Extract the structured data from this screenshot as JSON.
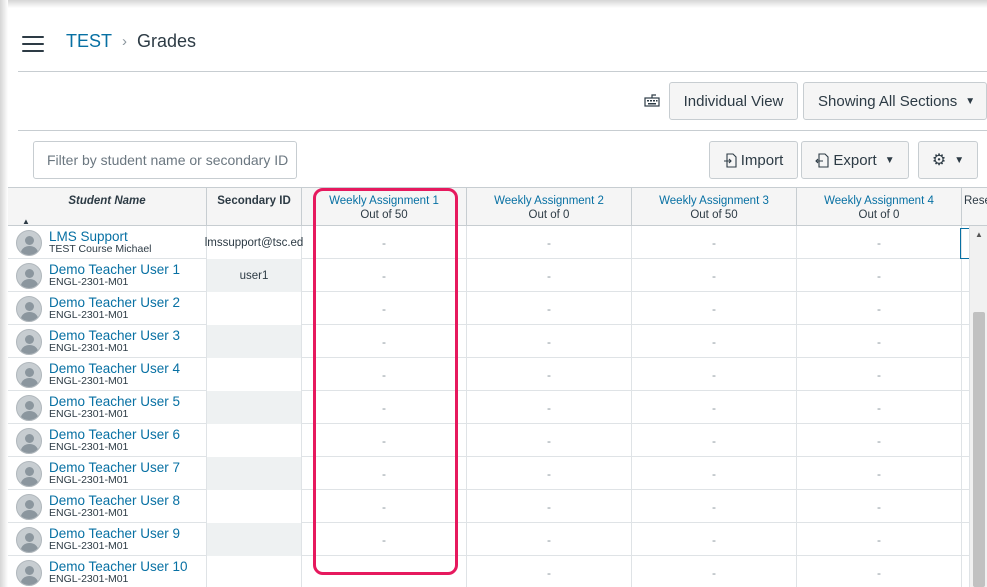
{
  "header": {
    "course": "TEST",
    "page": "Grades"
  },
  "toolbar": {
    "individual_view": "Individual View",
    "sections": "Showing All Sections",
    "import": "Import",
    "export": "Export",
    "filter_placeholder": "Filter by student name or secondary ID"
  },
  "columns": {
    "student": "Student Name",
    "secondary": "Secondary ID",
    "a1_title": "Weekly Assignment 1",
    "a1_sub": "Out of 50",
    "a2_title": "Weekly Assignment 2",
    "a2_sub": "Out of 0",
    "a3_title": "Weekly Assignment 3",
    "a3_sub": "Out of 50",
    "a4_title": "Weekly Assignment 4",
    "a4_sub": "Out of 0",
    "next_title": "Rese"
  },
  "rows": [
    {
      "name": "LMS Support",
      "section": "TEST Course Michael",
      "secondary": "lmssupport@tsc.ed",
      "g1": "-",
      "g2": "-",
      "g3": "-",
      "g4": "-"
    },
    {
      "name": "Demo Teacher User 1",
      "section": "ENGL-2301-M01",
      "secondary": "user1",
      "g1": "-",
      "g2": "-",
      "g3": "-",
      "g4": "-"
    },
    {
      "name": "Demo Teacher User 2",
      "section": "ENGL-2301-M01",
      "secondary": "",
      "g1": "-",
      "g2": "-",
      "g3": "-",
      "g4": "-"
    },
    {
      "name": "Demo Teacher User 3",
      "section": "ENGL-2301-M01",
      "secondary": "",
      "g1": "-",
      "g2": "-",
      "g3": "-",
      "g4": "-"
    },
    {
      "name": "Demo Teacher User 4",
      "section": "ENGL-2301-M01",
      "secondary": "",
      "g1": "-",
      "g2": "-",
      "g3": "-",
      "g4": "-"
    },
    {
      "name": "Demo Teacher User 5",
      "section": "ENGL-2301-M01",
      "secondary": "",
      "g1": "-",
      "g2": "-",
      "g3": "-",
      "g4": "-"
    },
    {
      "name": "Demo Teacher User 6",
      "section": "ENGL-2301-M01",
      "secondary": "",
      "g1": "-",
      "g2": "-",
      "g3": "-",
      "g4": "-"
    },
    {
      "name": "Demo Teacher User 7",
      "section": "ENGL-2301-M01",
      "secondary": "",
      "g1": "-",
      "g2": "-",
      "g3": "-",
      "g4": "-"
    },
    {
      "name": "Demo Teacher User 8",
      "section": "ENGL-2301-M01",
      "secondary": "",
      "g1": "-",
      "g2": "-",
      "g3": "-",
      "g4": "-"
    },
    {
      "name": "Demo Teacher User 9",
      "section": "ENGL-2301-M01",
      "secondary": "",
      "g1": "-",
      "g2": "-",
      "g3": "-",
      "g4": "-"
    },
    {
      "name": "Demo Teacher User 10",
      "section": "ENGL-2301-M01",
      "secondary": "",
      "g1": "",
      "g2": "-",
      "g3": "-",
      "g4": "-"
    }
  ],
  "colors": {
    "link": "#0770a3",
    "highlight": "#e6195e",
    "text": "#2d3b45"
  },
  "icons": {
    "menu": "hamburger-icon",
    "keyboard": "keyboard-icon",
    "import": "import-icon",
    "export": "export-icon",
    "settings": "gear-icon"
  }
}
